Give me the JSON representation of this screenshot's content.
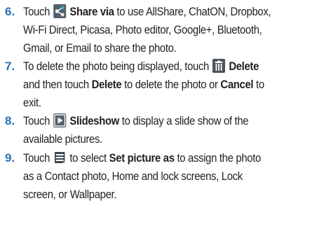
{
  "steps": [
    {
      "number": "6.",
      "parts": {
        "t1": "Touch",
        "b1": "Share via",
        "t2": "to use AllShare, ChatON, Dropbox,",
        "line2": "Wi-Fi Direct, Picasa, Photo editor, Google+, Bluetooth,",
        "line3": "Gmail, or Email to share the photo."
      },
      "icon": "share-icon"
    },
    {
      "number": "7.",
      "parts": {
        "t1": "To delete the photo being displayed, touch",
        "b1": "Delete",
        "t2": "and then touch",
        "b2": "Delete",
        "t3": "to delete the photo or",
        "b3": "Cancel",
        "t4": "to",
        "line3": "exit."
      },
      "icon": "delete-icon"
    },
    {
      "number": "8.",
      "parts": {
        "t1": "Touch",
        "b1": "Slideshow",
        "t2": "to display a slide show of the",
        "line2": "available pictures."
      },
      "icon": "slideshow-icon"
    },
    {
      "number": "9.",
      "parts": {
        "t1": "Touch",
        "t2": "to select",
        "b1": "Set picture as",
        "t3": "to assign the photo",
        "line2": "as a Contact photo, Home and lock screens, Lock",
        "line3": "screen, or Wallpaper."
      },
      "icon": "menu-icon"
    }
  ],
  "colors": {
    "step_number": "#2b6fb6",
    "text": "#231f20",
    "icon": "#55606a"
  }
}
